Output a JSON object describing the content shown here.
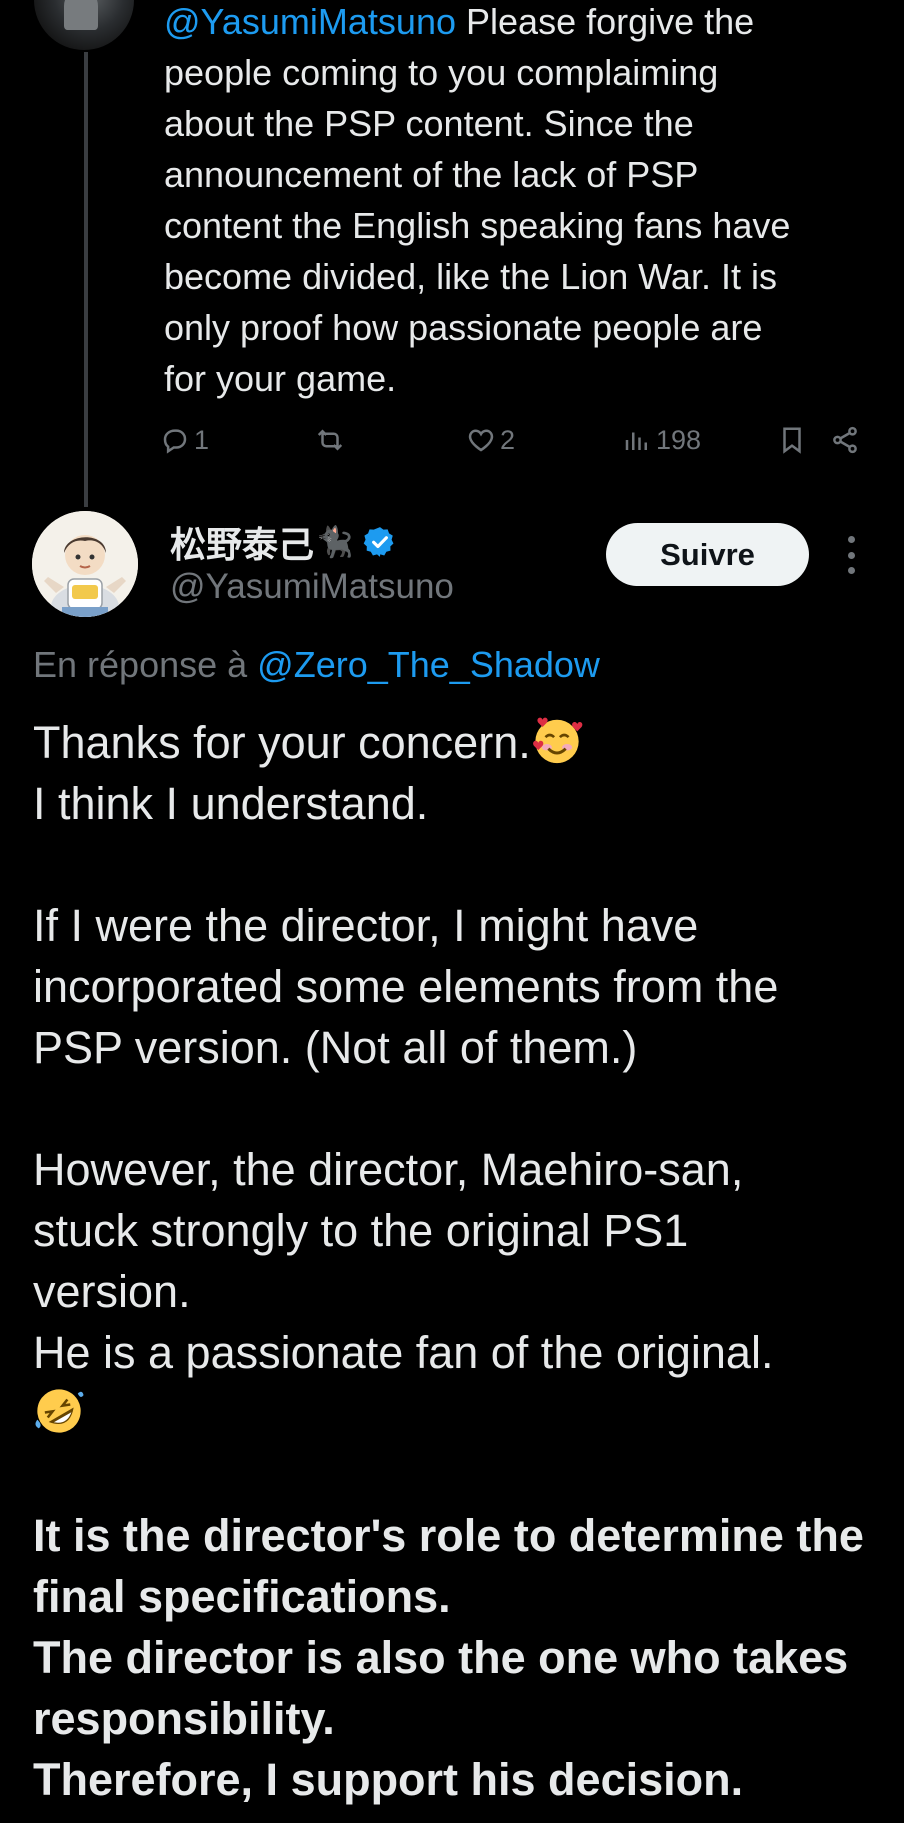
{
  "previous_tweet": {
    "mention": "@YasumiMatsuno",
    "lines": [
      "Please forgive the",
      "people coming to you complaiming",
      "about the PSP content. Since the",
      "announcement of the lack of PSP",
      "content the English speaking fans have",
      "become divided, like the Lion War. It is",
      "only proof how passionate people are",
      "for your game."
    ],
    "actions": {
      "replies": "1",
      "likes": "2",
      "views": "198"
    }
  },
  "main_tweet": {
    "display_name": "松野泰己",
    "name_emoji": "🐈‍⬛",
    "handle": "@YasumiMatsuno",
    "follow_label": "Suivre",
    "reply_prefix": "En réponse à",
    "reply_mention": "@Zero_The_Shadow",
    "body": [
      "Thanks for your concern.",
      "I think I understand.",
      "",
      "If I were the director, I might have",
      "incorporated some elements from the",
      "PSP version. (Not all of them.)",
      "",
      "However, the director, Maehiro-san,",
      "stuck strongly to the original PS1",
      "version.",
      "He is a passionate fan of the original.",
      "",
      "",
      "It is the director's role to determine the",
      "final specifications.",
      "The director is also the one who takes",
      "responsibility.",
      "Therefore, I support his decision."
    ]
  },
  "colors": {
    "background": "#000000",
    "text": "#e7e9ea",
    "secondary": "#71767b",
    "link": "#1d9bf0",
    "verified": "#1d9bf0",
    "follow_bg": "#eff3f4"
  },
  "icons": {
    "reply": "reply-icon",
    "retweet": "retweet-icon",
    "like": "heart-icon",
    "views": "views-icon",
    "bookmark": "bookmark-icon",
    "share": "share-icon",
    "verified": "verified-badge-icon",
    "more": "more-options-icon",
    "smiling_face_with_hearts": "smiling-face-with-hearts-emoji",
    "rolling_on_floor_laughing": "rolling-on-floor-laughing-emoji"
  }
}
